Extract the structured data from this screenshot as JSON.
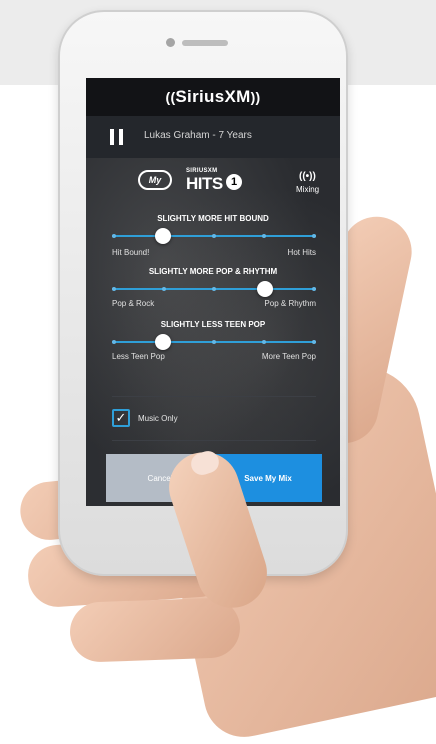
{
  "brand": {
    "name": "SiriusXM"
  },
  "now_playing": {
    "track": "Lukas Graham - 7 Years"
  },
  "logos": {
    "my_badge": "My",
    "hits_small": "SIRIUSXM",
    "hits_big": "HITS",
    "hits_num": "1",
    "mix_label": "Mixing"
  },
  "sliders": [
    {
      "title": "SLIGHTLY MORE HIT BOUND",
      "left_label": "Hit Bound!",
      "right_label": "Hot Hits",
      "level": 0.25
    },
    {
      "title": "SLIGHTLY MORE POP & RHYTHM",
      "left_label": "Pop & Rock",
      "right_label": "Pop & Rhythm",
      "level": 0.75
    },
    {
      "title": "SLIGHTLY LESS TEEN POP",
      "left_label": "Less Teen Pop",
      "right_label": "More Teen Pop",
      "level": 0.25
    }
  ],
  "music_only": {
    "label": "Music Only",
    "checked": true
  },
  "buttons": {
    "cancel": "Cancel",
    "save": "Save My Mix"
  },
  "colors": {
    "accent": "#1d8fe0",
    "cancel": "#b4bcc6"
  }
}
